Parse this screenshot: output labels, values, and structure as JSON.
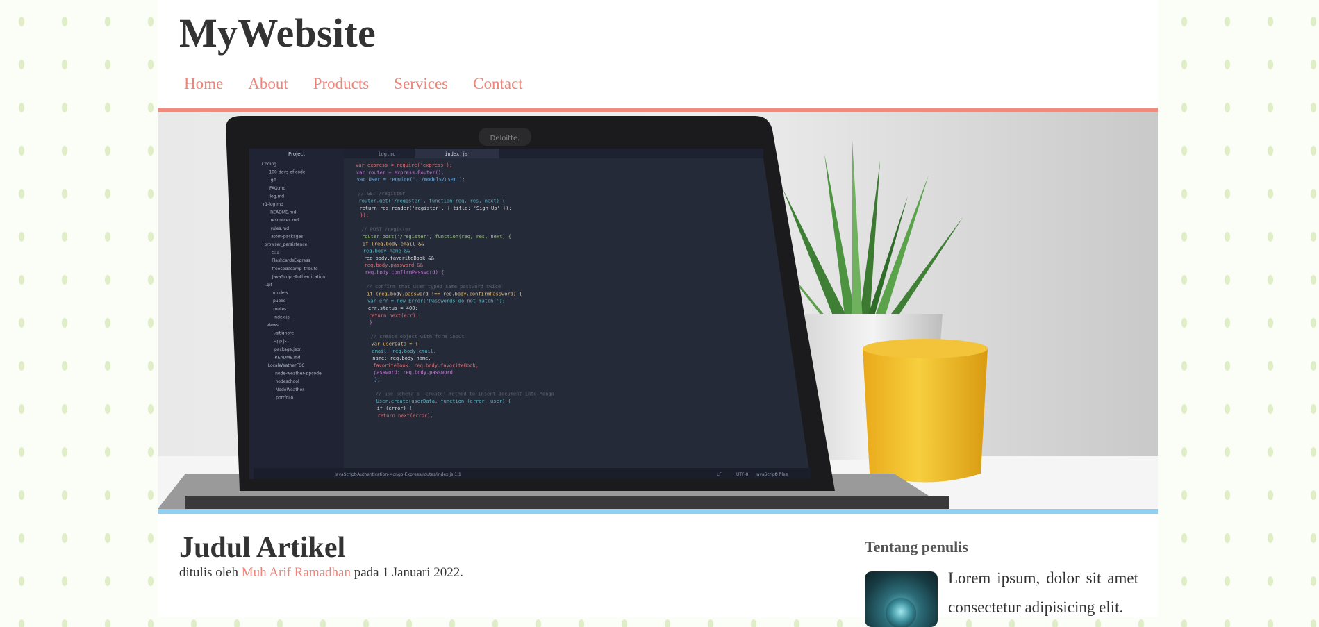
{
  "site": {
    "title": "MyWebsite"
  },
  "nav": {
    "items": [
      "Home",
      "About",
      "Products",
      "Services",
      "Contact"
    ]
  },
  "colors": {
    "accent": "#ee8378",
    "top_bar": "#f08b7e",
    "bottom_bar": "#8fd0f3",
    "text": "#333333"
  },
  "hero": {
    "image": "laptop-code-editor-photo",
    "tabs": [
      "log.md",
      "index.js"
    ],
    "sidebar_header": "Project",
    "files": [
      "Coding",
      "100-days-of-code",
      ".git",
      "FAQ.md",
      "log.md",
      "r1-log.md",
      "README.md",
      "resources.md",
      "rules.md",
      "atom-packages",
      "browser_persistence",
      "c01",
      "FlashcardsExpress",
      "freecodecamp_tribute",
      "JavaScript-Authentication",
      ".git",
      "models",
      "public",
      "routes",
      "index.js",
      "views",
      ".gitignore",
      "app.js",
      "package.json",
      "README.md",
      "LocalWeatherFCC",
      "node-weather-zipcode",
      "nodeschool",
      "NodeWeather",
      "portfolio"
    ],
    "code": [
      "var express = require('express');",
      "var router = express.Router();",
      "var User = require('../models/user');",
      "",
      "// GET /register",
      "router.get('/register', function(req, res, next) {",
      "  return res.render('register', { title: 'Sign Up' });",
      "});",
      "",
      "// POST /register",
      "router.post('/register', function(req, res, next) {",
      "  if (req.body.email &&",
      "    req.body.name &&",
      "    req.body.favoriteBook &&",
      "    req.body.password &&",
      "    req.body.confirmPassword) {",
      "",
      "    // confirm that user typed same password twice",
      "    if (req.body.password !== req.body.confirmPassword) {",
      "      var err = new Error('Passwords do not match.');",
      "      err.status = 400;",
      "      return next(err);",
      "    }",
      "",
      "    // create object with form input",
      "    var userData = {",
      "      email: req.body.email,",
      "      name: req.body.name,",
      "      favoriteBook: req.body.favoriteBook,",
      "      password: req.body.password",
      "    };",
      "",
      "    // use schema's 'create' method to insert document into Mongo",
      "    User.create(userData, function (error, user) {",
      "      if (error) {",
      "        return next(error);"
    ],
    "status_left": "JavaScript-Authentication-Mongo-Express/routes/index.js   1:1",
    "status_right": [
      "LF",
      "UTF-8",
      "JavaScript",
      "0 files"
    ],
    "bezel_label": "Deloitte."
  },
  "article": {
    "title": "Judul Artikel",
    "byline_prefix": "ditulis oleh",
    "author": "Muh Arif Ramadhan",
    "byline_suffix": "pada 1 Januari 2022."
  },
  "sidebar": {
    "heading": "Tentang penulis",
    "about": "Lorem ipsum, dolor sit amet consectetur adipisicing elit."
  }
}
